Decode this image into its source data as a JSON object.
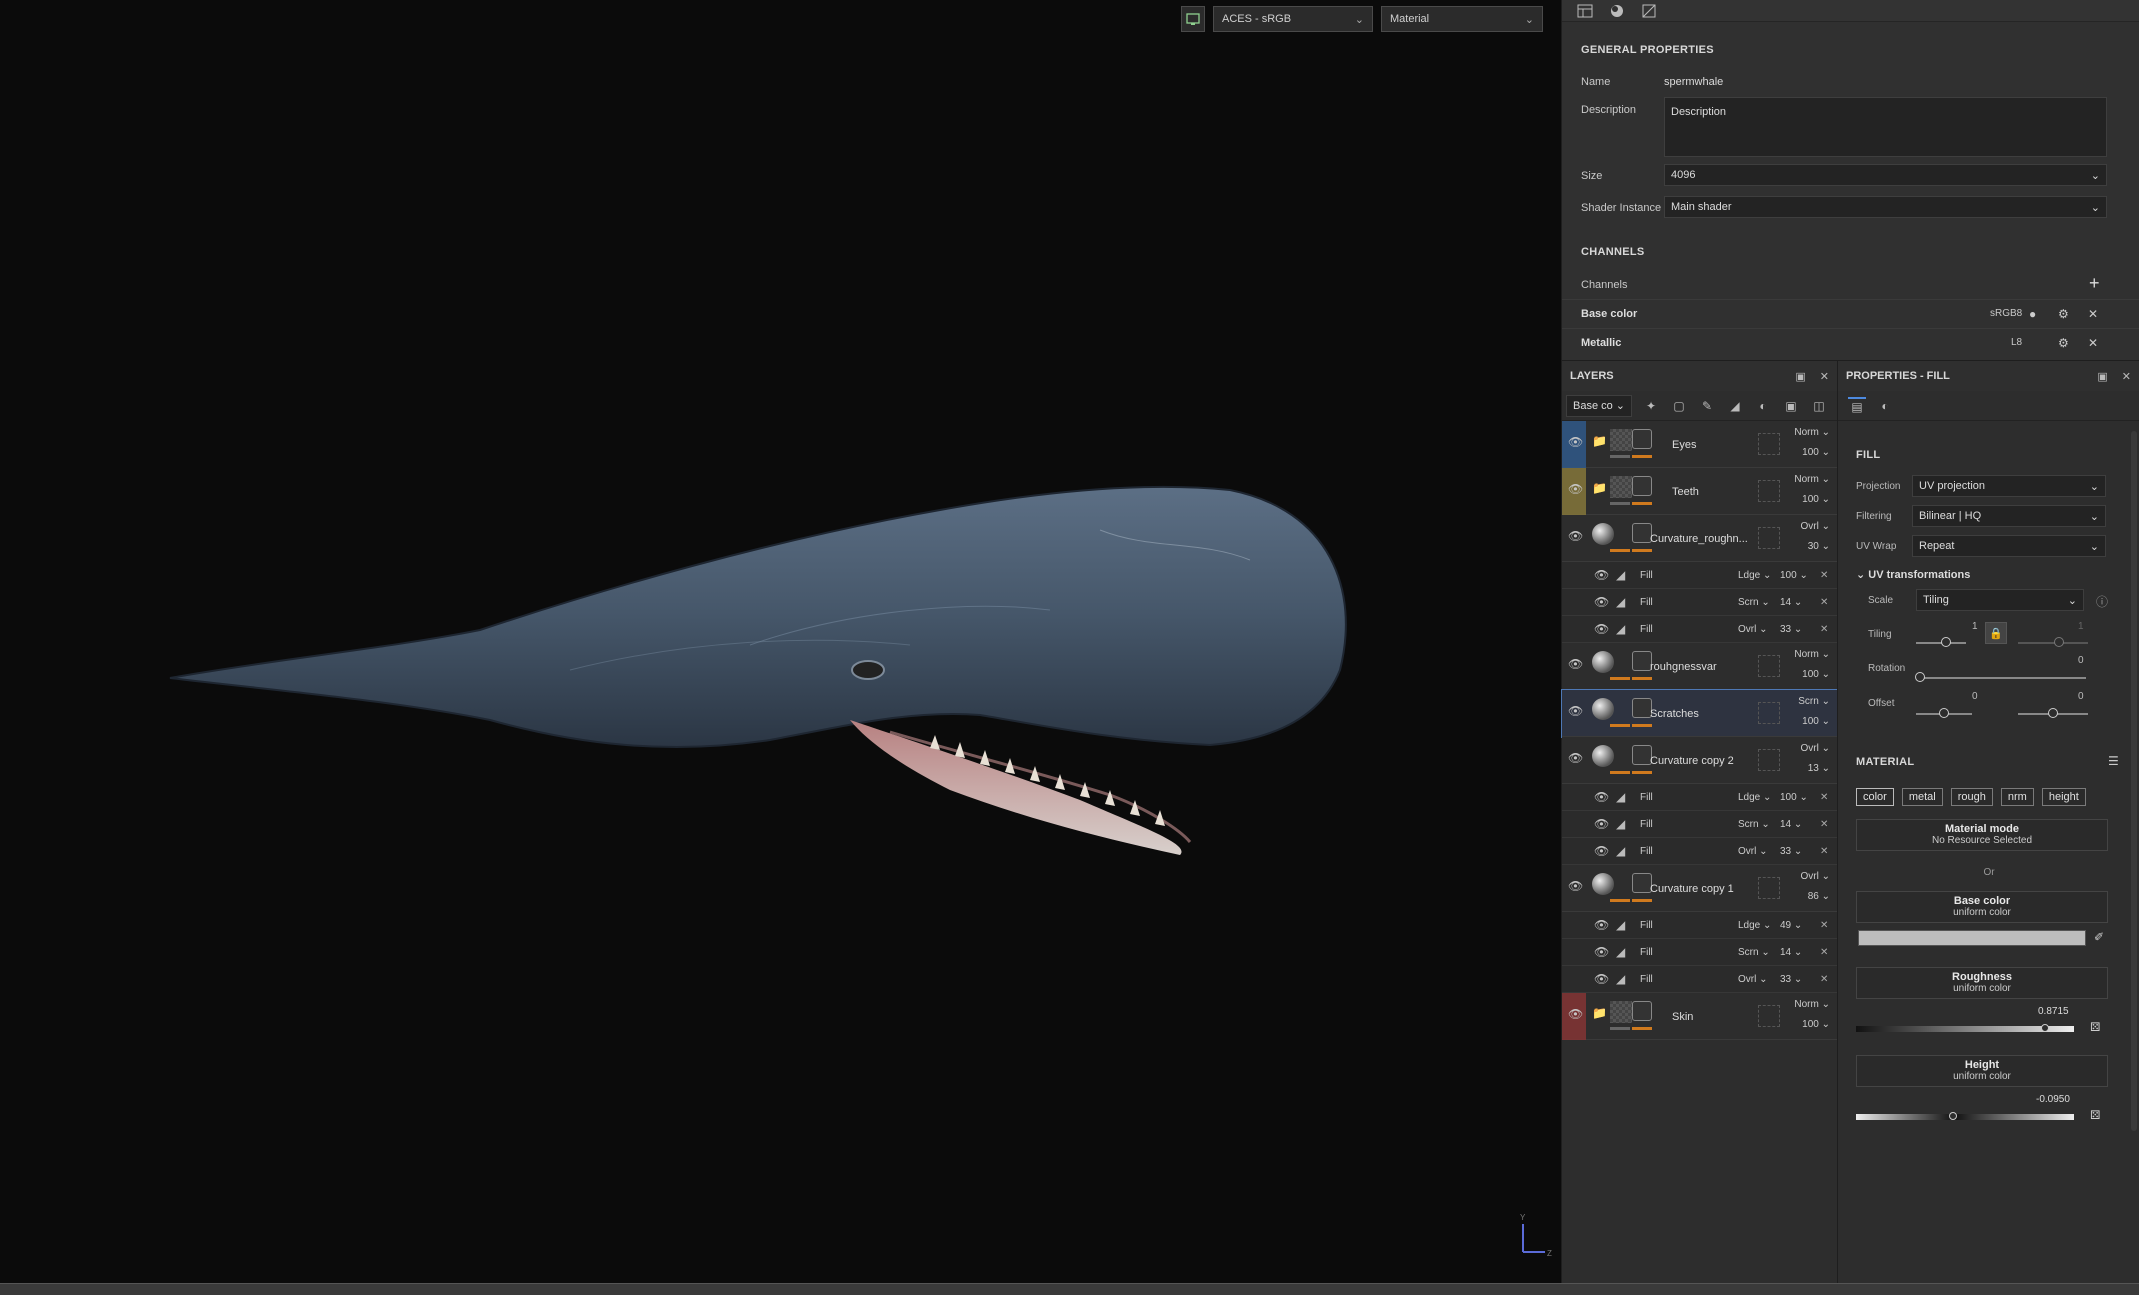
{
  "viewport": {
    "colorspace": "ACES - sRGB",
    "mode": "Material",
    "gizmo_axes": [
      "Y",
      "Z"
    ]
  },
  "texture_set": {
    "section_general": "GENERAL PROPERTIES",
    "name_label": "Name",
    "name_value": "spermwhale",
    "description_label": "Description",
    "description_value": "Description",
    "size_label": "Size",
    "size_value": "4096",
    "shader_label": "Shader Instance",
    "shader_value": "Main shader",
    "section_channels": "CHANNELS",
    "channels_label": "Channels",
    "channels": [
      {
        "name": "Base color",
        "format": "sRGB8"
      },
      {
        "name": "Metallic",
        "format": "L8"
      }
    ]
  },
  "layers": {
    "title": "LAYERS",
    "channel_select": "Base co",
    "items": [
      {
        "name": "Eyes",
        "blend": "Norm",
        "opacity": "100",
        "color": "#2f5b8f"
      },
      {
        "name": "Teeth",
        "blend": "Norm",
        "opacity": "100",
        "color": "#8a7a3b"
      },
      {
        "name": "Curvature_roughn...",
        "blend": "Ovrl",
        "opacity": "30",
        "color": "",
        "subs": [
          {
            "name": "Fill",
            "blend": "Ldge",
            "opacity": "100"
          },
          {
            "name": "Fill",
            "blend": "Scrn",
            "opacity": "14"
          },
          {
            "name": "Fill",
            "blend": "Ovrl",
            "opacity": "33"
          }
        ]
      },
      {
        "name": "rouhgnessvar",
        "blend": "Norm",
        "opacity": "100",
        "color": ""
      },
      {
        "name": "Scratches",
        "blend": "Scrn",
        "opacity": "100",
        "color": ""
      },
      {
        "name": "Curvature copy 2",
        "blend": "Ovrl",
        "opacity": "13",
        "color": "",
        "subs": [
          {
            "name": "Fill",
            "blend": "Ldge",
            "opacity": "100"
          },
          {
            "name": "Fill",
            "blend": "Scrn",
            "opacity": "14"
          },
          {
            "name": "Fill",
            "blend": "Ovrl",
            "opacity": "33"
          }
        ]
      },
      {
        "name": "Curvature copy 1",
        "blend": "Ovrl",
        "opacity": "86",
        "color": "",
        "subs": [
          {
            "name": "Fill",
            "blend": "Ldge",
            "opacity": "49"
          },
          {
            "name": "Fill",
            "blend": "Scrn",
            "opacity": "14"
          },
          {
            "name": "Fill",
            "blend": "Ovrl",
            "opacity": "33"
          }
        ]
      },
      {
        "name": "Skin",
        "blend": "Norm",
        "opacity": "100",
        "color": "#8a3535"
      }
    ]
  },
  "properties": {
    "title": "PROPERTIES - FILL",
    "fill_head": "FILL",
    "projection_label": "Projection",
    "projection": "UV projection",
    "filtering_label": "Filtering",
    "filtering": "Bilinear | HQ",
    "uvwrap_label": "UV Wrap",
    "uvwrap": "Repeat",
    "uvt_head": "UV transformations",
    "scale_label": "Scale",
    "scale": "Tiling",
    "tiling_label": "Tiling",
    "tiling_a": "1",
    "tiling_b": "1",
    "tiling_fraction": 0.5,
    "rotation_label": "Rotation",
    "rotation": "0",
    "rotation_fraction": 0.0,
    "offset_label": "Offset",
    "offset_a": "0",
    "offset_b": "0",
    "offset_fraction": 0.5,
    "material_head": "MATERIAL",
    "mat_tabs": [
      "color",
      "metal",
      "rough",
      "nrm",
      "height"
    ],
    "mode_title": "Material mode",
    "mode_sub": "No Resource Selected",
    "or": "Or",
    "base_title": "Base color",
    "base_sub": "uniform color",
    "rough_title": "Roughness",
    "rough_sub": "uniform color",
    "rough_value": "0.8715",
    "rough_fraction": 0.8715,
    "height_title": "Height",
    "height_sub": "uniform color",
    "height_value": "-0.0950",
    "height_fraction": 0.45
  }
}
